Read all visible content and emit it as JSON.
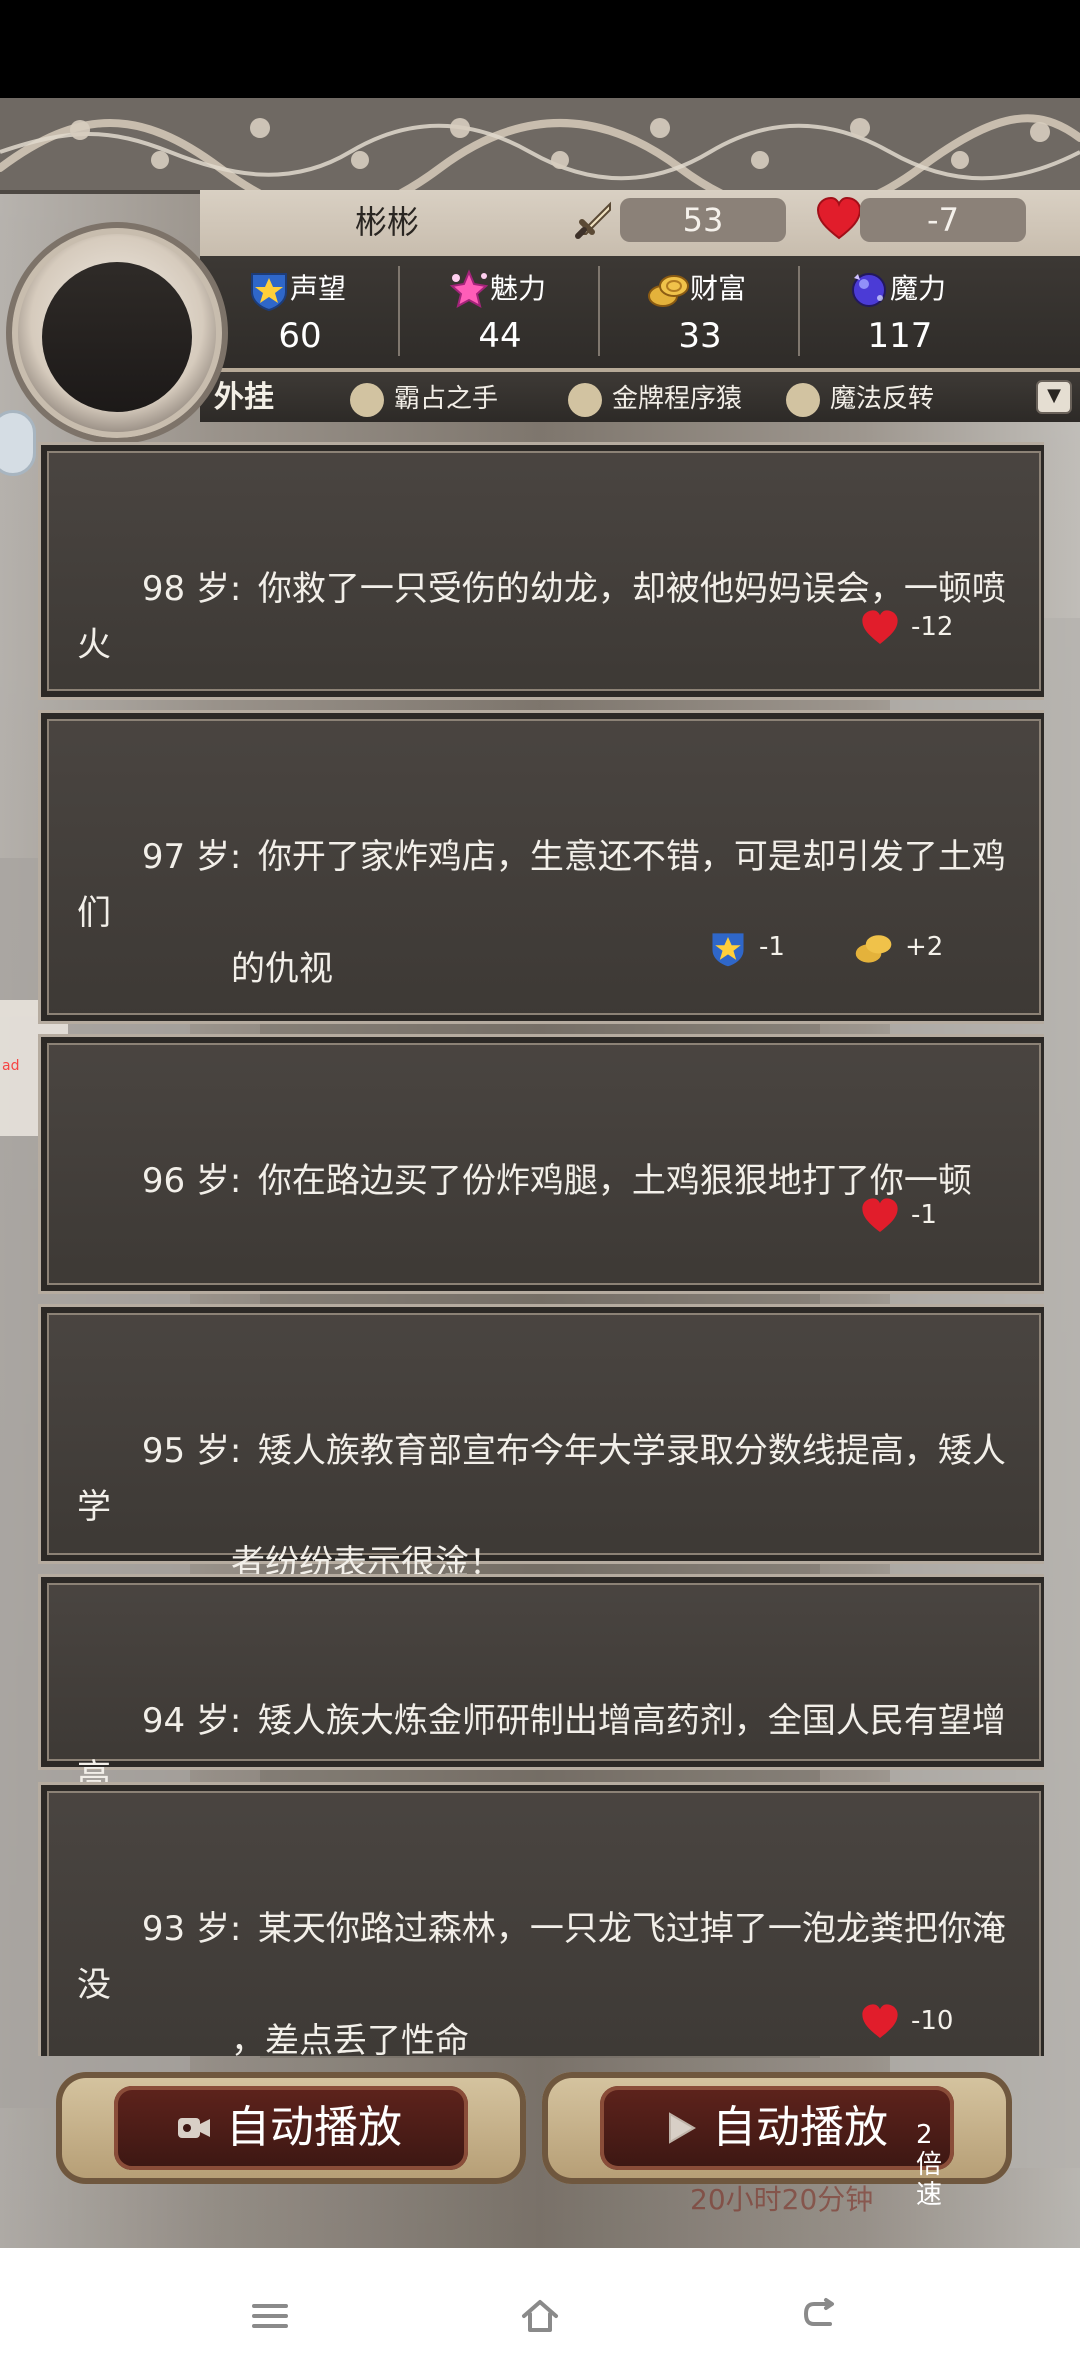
{
  "player": {
    "name": "彬彬",
    "attack": "53",
    "health": "-7"
  },
  "attributes": [
    {
      "label": "声望",
      "value": "60",
      "icon": "reputation-badge-icon"
    },
    {
      "label": "魅力",
      "value": "44",
      "icon": "charm-sparkle-icon"
    },
    {
      "label": "财富",
      "value": "33",
      "icon": "coins-icon"
    },
    {
      "label": "魔力",
      "value": "117",
      "icon": "magic-orb-icon"
    }
  ],
  "plugins": {
    "title": "外挂",
    "items": [
      {
        "name": "霸占之手"
      },
      {
        "name": "金牌程序猿"
      },
      {
        "name": "魔法反转"
      }
    ]
  },
  "events": [
    {
      "age": "98 岁:",
      "text": "你救了一只受伤的幼龙，却被他妈妈误会，一顿喷火",
      "text2": "",
      "effects": [
        {
          "icon": "heart-icon",
          "value": "-12"
        }
      ]
    },
    {
      "age": "97 岁:",
      "text": "你开了家炸鸡店，生意还不错，可是却引发了土鸡们",
      "text2": "的仇视",
      "effects": [
        {
          "icon": "reputation-badge-icon",
          "value": "-1"
        },
        {
          "icon": "coins-icon",
          "value": "+2"
        }
      ]
    },
    {
      "age": "96 岁:",
      "text": "你在路边买了份炸鸡腿，土鸡狠狠地打了你一顿",
      "text2": "",
      "effects": [
        {
          "icon": "heart-icon",
          "value": "-1"
        }
      ]
    },
    {
      "age": "95 岁:",
      "text": "矮人族教育部宣布今年大学录取分数线提高，矮人学",
      "text2": "者纷纷表示很淦！",
      "effects": []
    },
    {
      "age": "94 岁:",
      "text": "矮人族大炼金师研制出增高药剂，全国人民有望增高",
      "text2": "",
      "effects": []
    },
    {
      "age": "93 岁:",
      "text": "某天你路过森林，一只龙飞过掉了一泡龙粪把你淹没",
      "text2": "，差点丢了性命",
      "effects": [
        {
          "icon": "heart-icon",
          "value": "-10"
        }
      ]
    }
  ],
  "controls": {
    "auto_play": "自动播放",
    "auto_play_fast": "自动播放",
    "speed_label": "2倍速",
    "timer_text": "20小时20分钟"
  },
  "side_tab_text": "ad",
  "colors": {
    "card_bg": "#433f3b",
    "accent_gold": "#d8b35a",
    "heart": "#e11d2b",
    "button_red": "#5e231c"
  }
}
